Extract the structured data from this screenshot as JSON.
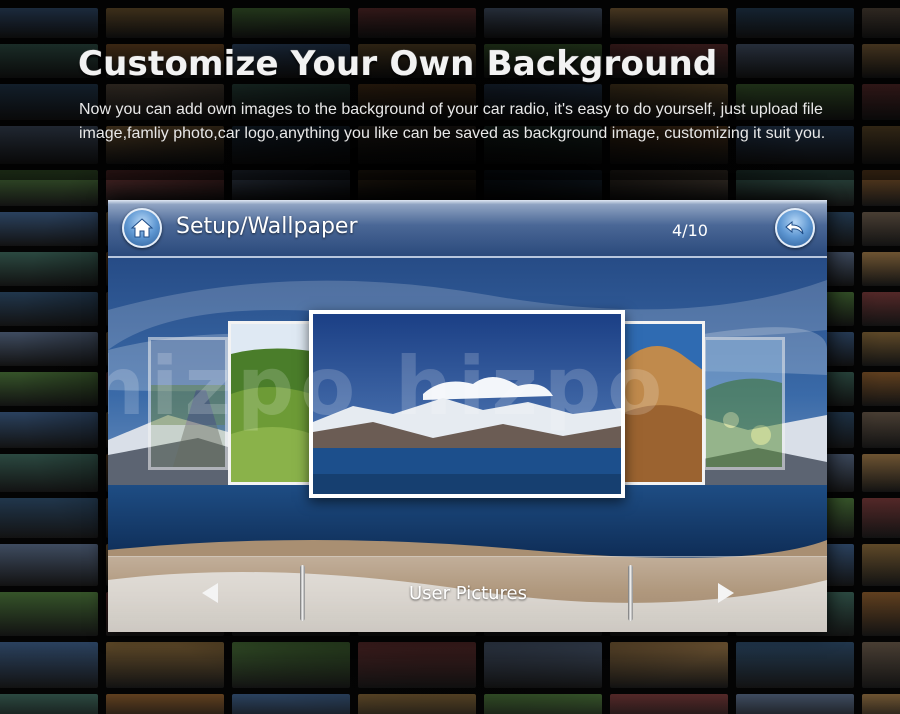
{
  "promo": {
    "headline": "Customize Your Own Background",
    "description": "Now you can add own images to the background of your car radio, it's easy to do yourself, just upload file image,famliy photo,car logo,anything you like can be saved as background image, customizing it suit you."
  },
  "device": {
    "title": "Setup/Wallpaper",
    "page_counter": "4/10",
    "home_icon": "home-icon",
    "back_icon": "back-arrow-icon",
    "watermark": "hizpo hizpo",
    "carousel": {
      "selected_index": 2,
      "thumbnails": [
        "road",
        "green-hills",
        "mountain-lake",
        "desert-dune",
        "wildflowers"
      ]
    },
    "control_bar": {
      "label": "User Pictures",
      "prev_icon": "triangle-left-icon",
      "next_icon": "triangle-right-icon"
    }
  },
  "colors": {
    "accent": "#3a74bf",
    "titlebar": "#2b4a7c",
    "text": "#ffffff"
  }
}
